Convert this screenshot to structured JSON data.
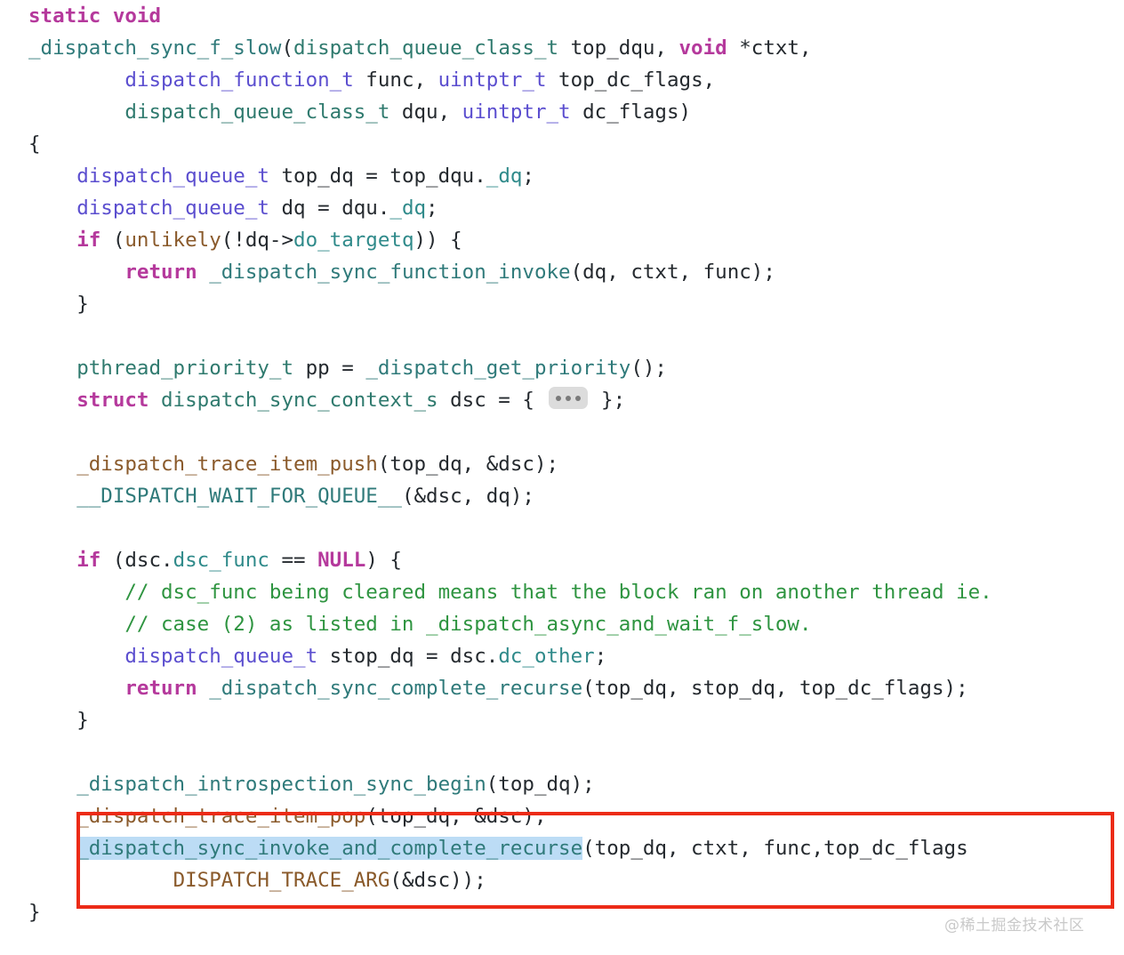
{
  "editor": {
    "language": "c",
    "background": "#ffffff",
    "font_size_px": 22.5,
    "line_height_px": 36,
    "colors": {
      "keyword": "#b5399c",
      "type": "#5b4ecf",
      "type_struct": "#2f7a6e",
      "function": "#2f7a7a",
      "member": "#2f8a8a",
      "macro": "#8a5a2b",
      "comment": "#2e9440",
      "plain_text": "#24292e",
      "selection_highlight": "#bcdcf5",
      "annotation_box": "#ec2b17",
      "ellipsis_badge_bg": "#dcdcdc",
      "ellipsis_badge_dot": "#7a7a7a",
      "watermark": "#c9c9c9"
    }
  },
  "code": {
    "lines": [
      {
        "indent": 0,
        "text": "static void"
      },
      {
        "indent": 0,
        "text": "_dispatch_sync_f_slow(dispatch_queue_class_t top_dqu, void *ctxt,"
      },
      {
        "indent": 0,
        "text": "        dispatch_function_t func, uintptr_t top_dc_flags,"
      },
      {
        "indent": 0,
        "text": "        dispatch_queue_class_t dqu, uintptr_t dc_flags)"
      },
      {
        "indent": 0,
        "text": "{"
      },
      {
        "indent": 1,
        "text": "dispatch_queue_t top_dq = top_dqu._dq;"
      },
      {
        "indent": 1,
        "text": "dispatch_queue_t dq = dqu._dq;"
      },
      {
        "indent": 1,
        "text": "if (unlikely(!dq->do_targetq)) {"
      },
      {
        "indent": 2,
        "text": "return _dispatch_sync_function_invoke(dq, ctxt, func);"
      },
      {
        "indent": 1,
        "text": "}"
      },
      {
        "indent": 0,
        "text": ""
      },
      {
        "indent": 1,
        "text": "pthread_priority_t pp = _dispatch_get_priority();"
      },
      {
        "indent": 1,
        "text": "struct dispatch_sync_context_s dsc = { ... };"
      },
      {
        "indent": 0,
        "text": ""
      },
      {
        "indent": 1,
        "text": "_dispatch_trace_item_push(top_dq, &dsc);"
      },
      {
        "indent": 1,
        "text": "__DISPATCH_WAIT_FOR_QUEUE__(&dsc, dq);"
      },
      {
        "indent": 0,
        "text": ""
      },
      {
        "indent": 1,
        "text": "if (dsc.dsc_func == NULL) {"
      },
      {
        "indent": 2,
        "text": "// dsc_func being cleared means that the block ran on another thread ie."
      },
      {
        "indent": 2,
        "text": "// case (2) as listed in _dispatch_async_and_wait_f_slow."
      },
      {
        "indent": 2,
        "text": "dispatch_queue_t stop_dq = dsc.dc_other;"
      },
      {
        "indent": 2,
        "text": "return _dispatch_sync_complete_recurse(top_dq, stop_dq, top_dc_flags);"
      },
      {
        "indent": 1,
        "text": "}"
      },
      {
        "indent": 0,
        "text": ""
      },
      {
        "indent": 1,
        "text": "_dispatch_introspection_sync_begin(top_dq);"
      },
      {
        "indent": 1,
        "text": "_dispatch_trace_item_pop(top_dq, &dsc);"
      },
      {
        "indent": 1,
        "text": "_dispatch_sync_invoke_and_complete_recurse(top_dq, ctxt, func,top_dc_flags"
      },
      {
        "indent": 3,
        "text": "DISPATCH_TRACE_ARG(&dsc));"
      },
      {
        "indent": 0,
        "text": "}"
      }
    ],
    "tokens": {
      "l0_static": "static",
      "l0_void": "void",
      "l1_fnname": "_dispatch_sync_f_slow",
      "l1_open": "(",
      "l1_type1": "dispatch_queue_class_t",
      "l1_arg1": " top_dqu, ",
      "l1_void": "void",
      "l1_arg2": " *ctxt,",
      "l2_type": "dispatch_function_t",
      "l2_rest": " func, ",
      "l2_type2": "uintptr_t",
      "l2_rest2": " top_dc_flags,",
      "l3_type": "dispatch_queue_class_t",
      "l3_rest": " dqu, ",
      "l3_type2": "uintptr_t",
      "l3_rest2": " dc_flags)",
      "l4_brace": "{",
      "l5_type": "dispatch_queue_t",
      "l5_rest": " top_dq = top_dqu.",
      "l5_member": "_dq",
      "l5_end": ";",
      "l6_type": "dispatch_queue_t",
      "l6_rest": " dq = dqu.",
      "l6_member": "_dq",
      "l6_end": ";",
      "l7_if": "if",
      "l7_open": " (",
      "l7_unlikely": "unlikely",
      "l7_mid": "(!dq->",
      "l7_member": "do_targetq",
      "l7_end": ")) {",
      "l8_return": "return",
      "l8_sp": " ",
      "l8_fn": "_dispatch_sync_function_invoke",
      "l8_args": "(dq, ctxt, func);",
      "l9_brace": "}",
      "l11_type": "pthread_priority_t",
      "l11_mid": " pp = ",
      "l11_fn": "_dispatch_get_priority",
      "l11_end": "();",
      "l12_struct": "struct",
      "l12_sp": " ",
      "l12_type": "dispatch_sync_context_s",
      "l12_mid": " dsc = { ",
      "l12_end": " };",
      "l14_macro": "_dispatch_trace_item_push",
      "l14_args": "(top_dq, &dsc);",
      "l15_fn": "__DISPATCH_WAIT_FOR_QUEUE__",
      "l15_args": "(&dsc, dq);",
      "l17_if": "if",
      "l17_mid": " (dsc.",
      "l17_member": "dsc_func",
      "l17_eq": " == ",
      "l17_null": "NULL",
      "l17_end": ") {",
      "l18_comment": "// dsc_func being cleared means that the block ran on another thread ie.",
      "l19_comment": "// case (2) as listed in _dispatch_async_and_wait_f_slow.",
      "l20_type": "dispatch_queue_t",
      "l20_mid": " stop_dq = dsc.",
      "l20_member": "dc_other",
      "l20_end": ";",
      "l21_return": "return",
      "l21_sp": " ",
      "l21_fn": "_dispatch_sync_complete_recurse",
      "l21_args": "(top_dq, stop_dq, top_dc_flags);",
      "l22_brace": "}",
      "l24_fn": "_dispatch_introspection_sync_begin",
      "l24_args": "(top_dq);",
      "l25_macro": "_dispatch_trace_item_pop",
      "l25_args": "(top_dq, &dsc);",
      "l26_fn": "_dispatch_sync_invoke_and_complete_recurse",
      "l26_args": "(top_dq, ctxt, func,top_dc_flags",
      "l27_macro": "DISPATCH_TRACE_ARG",
      "l27_args": "(&dsc));",
      "l28_brace": "}"
    }
  },
  "annotations": {
    "selection": {
      "text": "_dispatch_sync_invoke_and_complete_recurse",
      "color": "#bcdcf5"
    },
    "red_box": {
      "color": "#ec2b17",
      "border_width_px": 4
    },
    "ellipsis_badge": {
      "label": "...",
      "dots": 3,
      "meaning": "collapsed-code-region"
    }
  },
  "watermark": {
    "text": "@稀土掘金技术社区"
  }
}
